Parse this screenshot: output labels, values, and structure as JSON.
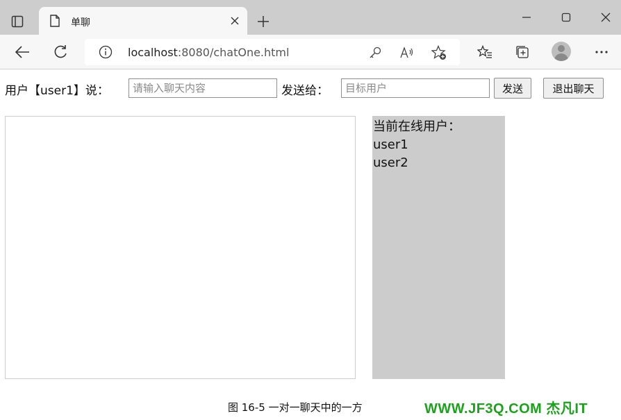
{
  "browser": {
    "tab": {
      "title": "单聊"
    },
    "address_bar": {
      "host": "localhost",
      "path": ":8080/chatOne.html"
    }
  },
  "page": {
    "say_label": "用户【user1】说：",
    "message_input": {
      "value": "",
      "placeholder": "请输入聊天内容"
    },
    "send_to_label": "发送给：",
    "target_input": {
      "value": "",
      "placeholder": "目标用户"
    },
    "send_button": "发送",
    "exit_button": "退出聊天",
    "online_panel": {
      "title": "当前在线用户：",
      "users": [
        "user1",
        "user2"
      ]
    }
  },
  "caption": "图 16-5  一对一聊天中的一方",
  "watermark": "WWW.JF3Q.COM 杰凡IT",
  "colors": {
    "tabstrip_bg": "#cdcdcd",
    "toolbar_bg": "#f7f7f7",
    "online_panel_bg": "#cccccc",
    "watermark": "#1aa31a"
  },
  "icons": {
    "tab_actions": "tab-actions-icon",
    "page": "page-icon",
    "close": "close-icon",
    "new_tab": "plus-icon",
    "back": "back-arrow-icon",
    "refresh": "refresh-icon",
    "info": "info-icon",
    "key": "key-icon",
    "read_aloud": "read-aloud-icon",
    "favorite_add": "favorite-add-icon",
    "favorites": "favorites-icon",
    "collections": "collections-icon",
    "profile": "profile-avatar",
    "more": "more-icon"
  }
}
